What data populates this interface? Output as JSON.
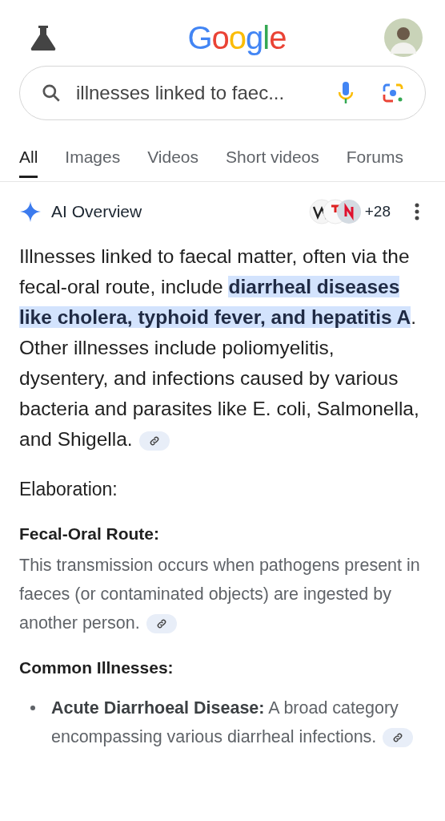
{
  "header": {
    "logo": "Google"
  },
  "search": {
    "value": "illnesses linked to faec..."
  },
  "tabs": [
    {
      "label": "All",
      "selected": true
    },
    {
      "label": "Images",
      "selected": false
    },
    {
      "label": "Videos",
      "selected": false
    },
    {
      "label": "Short videos",
      "selected": false
    },
    {
      "label": "Forums",
      "selected": false
    }
  ],
  "ai_overview": {
    "title": "AI Overview",
    "source_count": "+28",
    "summary_before": "Illnesses linked to faecal matter, often via the fecal-oral route, include ",
    "summary_highlight": "diarrheal diseases like cholera, typhoid fever, and hepatitis A",
    "summary_after": ". Other illnesses include poliomyelitis, dysentery, and infections caused by various bacteria and parasites like E. coli, Salmonella, and Shigella.",
    "heading": "Elaboration:",
    "sections": [
      {
        "kind": "paragraph",
        "title": "Fecal-Oral Route:",
        "text": "This transmission occurs when pathogens present in faeces (or contaminated objects) are ingested by another person."
      },
      {
        "kind": "list",
        "title": "Common Illnesses:",
        "items": [
          {
            "term": "Acute Diarrhoeal Disease:",
            "text": " A broad category encompassing various diarrheal infections."
          }
        ]
      }
    ]
  }
}
